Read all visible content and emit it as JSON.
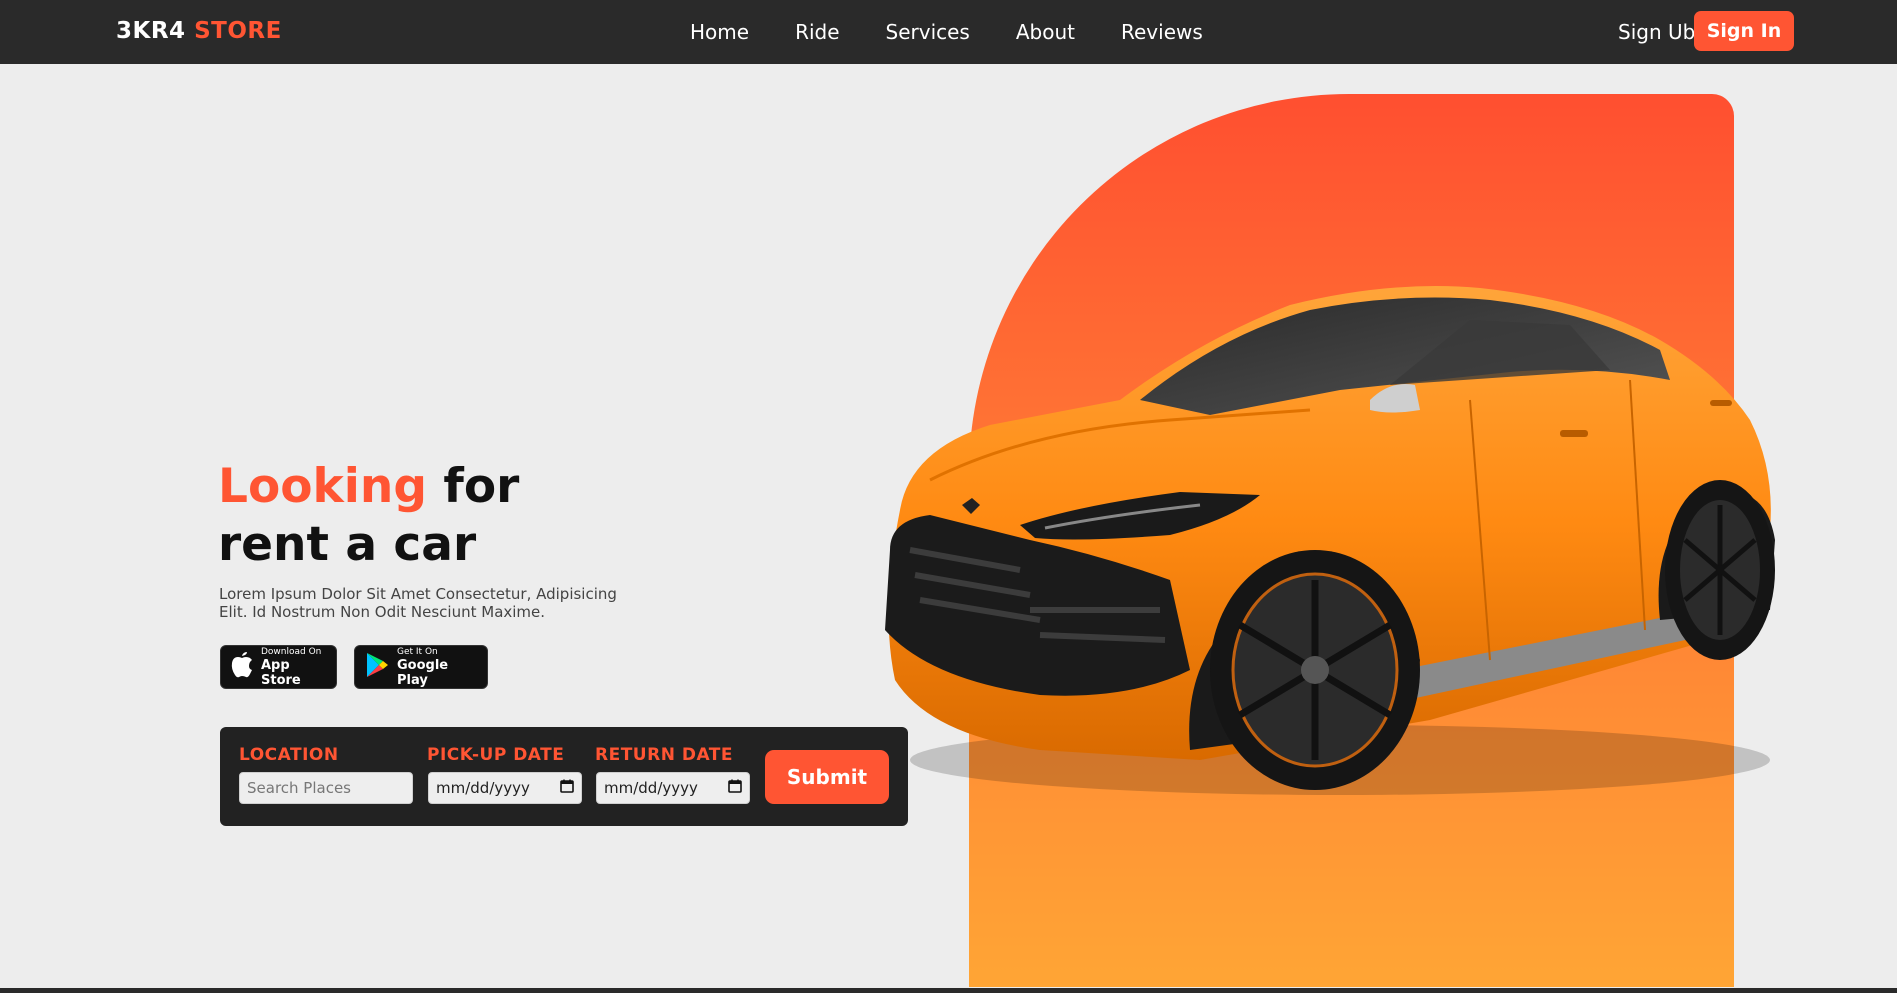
{
  "brand": {
    "part1": "3KR4",
    "part2": "STORE"
  },
  "nav": {
    "links": [
      "Home",
      "Ride",
      "Services",
      "About",
      "Reviews"
    ],
    "signup_label": "Sign Ub",
    "signin_label": "Sign In"
  },
  "hero": {
    "headline_accent": "Looking",
    "headline_rest": "for",
    "headline_line2": "rent a car",
    "description": "Lorem Ipsum Dolor Sit Amet Consectetur, Adipisicing Elit. Id Nostrum Non Odit Nesciunt Maxime."
  },
  "badges": {
    "apple": {
      "small": "Download On",
      "big": "App Store"
    },
    "google": {
      "small": "Get It On",
      "big": "Google Play"
    }
  },
  "form": {
    "location_label": "LOCATION",
    "location_placeholder": "Search Places",
    "pickup_label": "PICK-UP DATE",
    "pickup_value": "mm/dd/yyyy",
    "return_label": "RETURN DATE",
    "return_value": "mm/dd/yyyy",
    "submit_label": "Submit"
  },
  "colors": {
    "accent": "#ff5533",
    "nav_bg": "#2a2a2a",
    "page_bg": "#ededed",
    "panel_top": "#ff4f30",
    "panel_bottom": "#ffa535",
    "car_body": "#ff8c1a"
  }
}
